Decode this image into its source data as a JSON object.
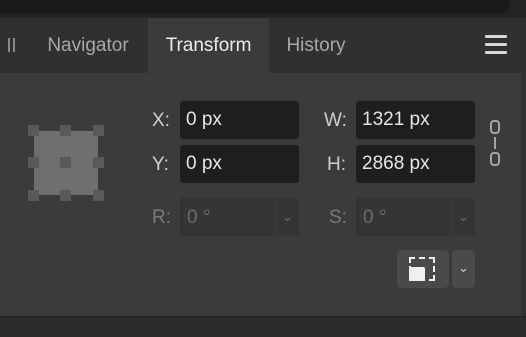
{
  "tabs": [
    {
      "label": "Navigator",
      "active": false
    },
    {
      "label": "Transform",
      "active": true
    },
    {
      "label": "History",
      "active": false
    }
  ],
  "icons": {
    "grip": "drag-grip-icon",
    "menu": "hamburger-menu-icon",
    "link": "chain-link-icon",
    "transform_origin": "bounding-box-origin-icon",
    "dropdown": "chevron-down-icon"
  },
  "transform": {
    "x": {
      "label": "X:",
      "value": "0 px"
    },
    "y": {
      "label": "Y:",
      "value": "0 px"
    },
    "w": {
      "label": "W:",
      "value": "1321 px"
    },
    "h": {
      "label": "H:",
      "value": "2868 px"
    },
    "r": {
      "label": "R:",
      "value": "0 °",
      "disabled": true
    },
    "s": {
      "label": "S:",
      "value": "0 °",
      "disabled": true
    }
  },
  "dropdown_glyph": "⌄",
  "colors": {
    "panel_bg": "#3b3b3b",
    "field_bg": "#1e1e1e",
    "text": "#e6e6e6"
  }
}
